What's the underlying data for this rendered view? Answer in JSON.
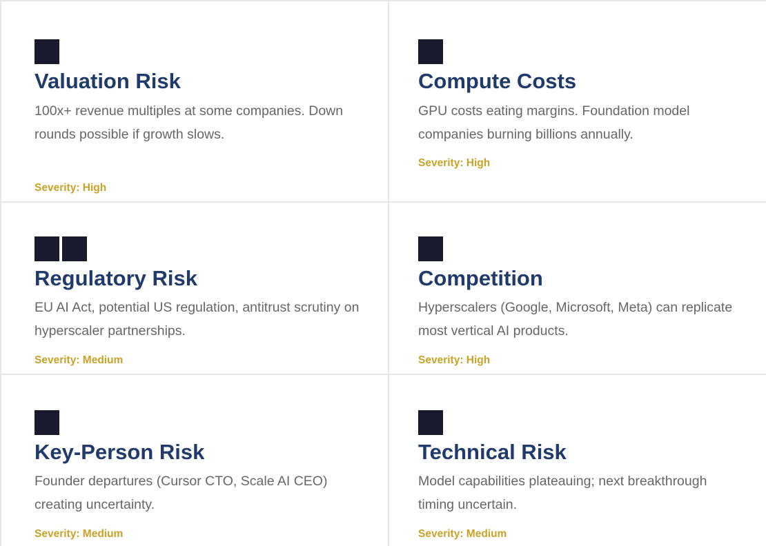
{
  "cards": [
    {
      "icon": "square-icon",
      "title": "Valuation Risk",
      "description": "100x+ revenue multiples at some companies. Down rounds possible if growth slows.",
      "severity": "Severity: High"
    },
    {
      "icon": "square-icon",
      "title": "Compute Costs",
      "description": "GPU costs eating margins. Foundation model companies burning billions annually.",
      "severity": "Severity: High"
    },
    {
      "icon": "double-square-icon",
      "title": "Regulatory Risk",
      "description": "EU AI Act, potential US regulation, antitrust scrutiny on hyperscaler partnerships.",
      "severity": "Severity: Medium"
    },
    {
      "icon": "square-icon",
      "title": "Competition",
      "description": "Hyperscalers (Google, Microsoft, Meta) can replicate most vertical AI products.",
      "severity": "Severity: High"
    },
    {
      "icon": "square-icon",
      "title": "Key-Person Risk",
      "description": "Founder departures (Cursor CTO, Scale AI CEO) creating uncertainty.",
      "severity": "Severity: Medium"
    },
    {
      "icon": "square-icon",
      "title": "Technical Risk",
      "description": "Model capabilities plateauing; next breakthrough timing uncertain.",
      "severity": "Severity: Medium"
    }
  ],
  "colors": {
    "title": "#1f3a6b",
    "severity": "#c9a227",
    "icon": "#1a1a2e",
    "divider": "#e5e5e7"
  }
}
